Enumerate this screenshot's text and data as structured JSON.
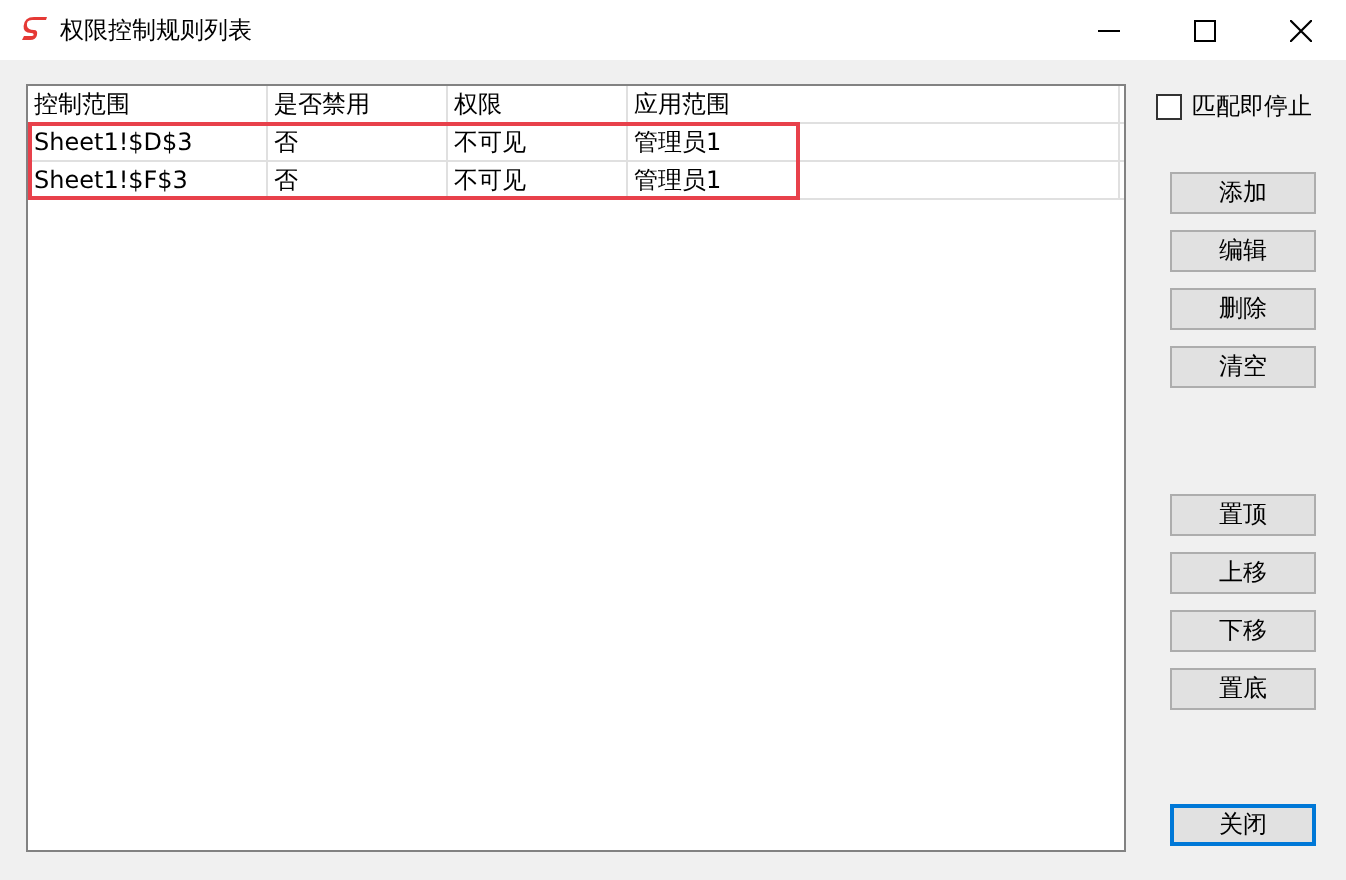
{
  "window": {
    "title": "权限控制规则列表"
  },
  "table": {
    "columns": [
      "控制范围",
      "是否禁用",
      "权限",
      "应用范围"
    ],
    "rows": [
      {
        "cells": [
          "Sheet1!$D$3",
          "否",
          "不可见",
          "管理员1"
        ],
        "highlighted": true
      },
      {
        "cells": [
          "Sheet1!$F$3",
          "否",
          "不可见",
          "管理员1"
        ],
        "highlighted": true
      }
    ]
  },
  "stop_on_match": {
    "label": "匹配即停止",
    "checked": false
  },
  "button_groups": [
    {
      "buttons": [
        {
          "label": "添加",
          "focused": false
        },
        {
          "label": "编辑",
          "focused": false
        },
        {
          "label": "删除",
          "focused": false
        },
        {
          "label": "清空",
          "focused": false
        }
      ]
    },
    {
      "buttons": [
        {
          "label": "置顶",
          "focused": false
        },
        {
          "label": "上移",
          "focused": false
        },
        {
          "label": "下移",
          "focused": false
        },
        {
          "label": "置底",
          "focused": false
        }
      ]
    },
    {
      "buttons": [
        {
          "label": "关闭",
          "focused": true
        }
      ]
    }
  ]
}
